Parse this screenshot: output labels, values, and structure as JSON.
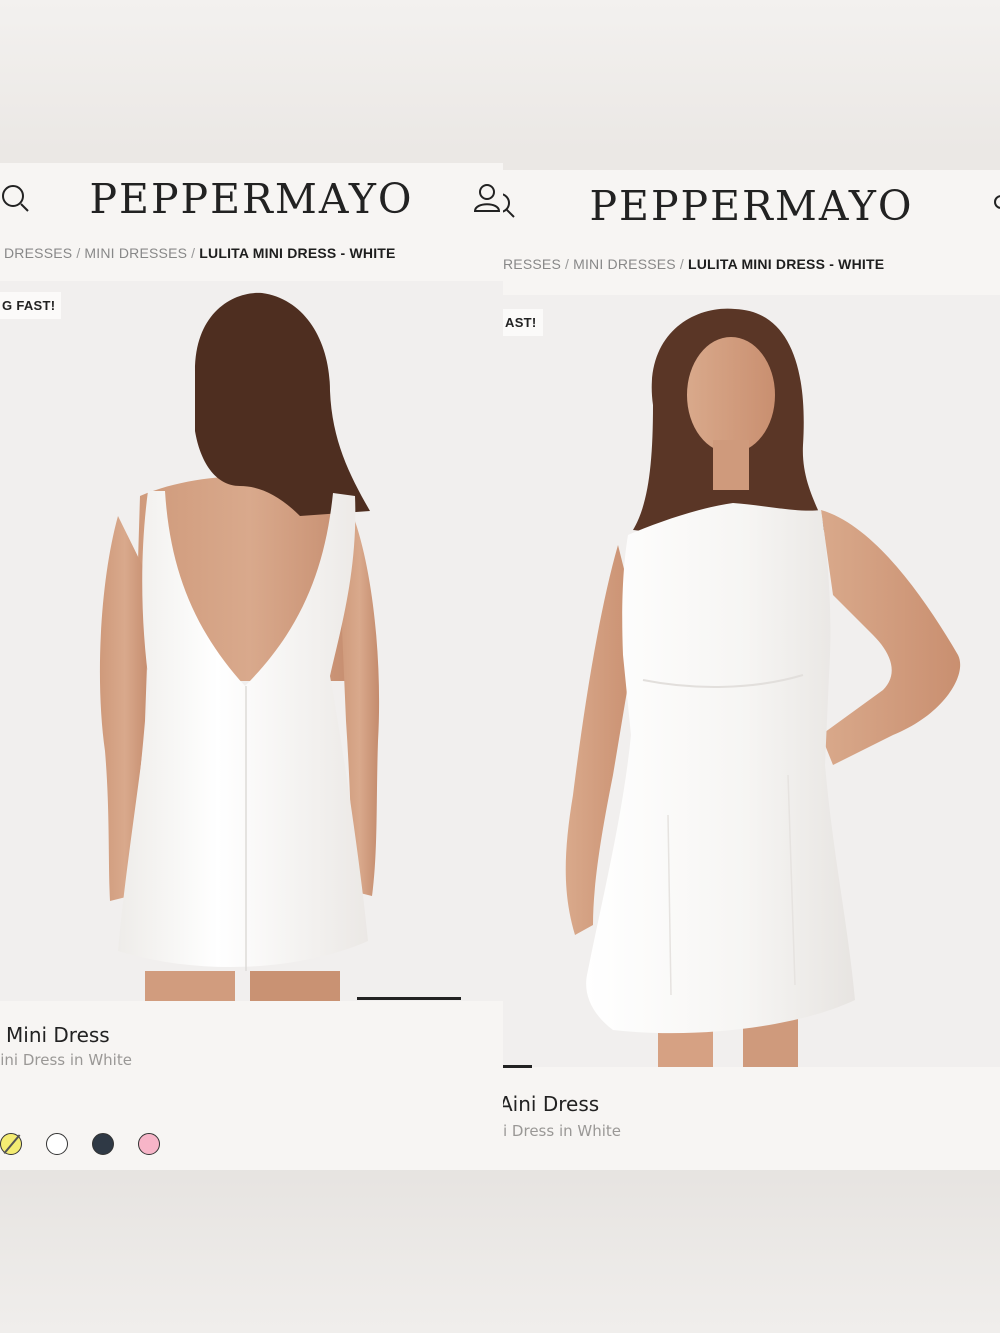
{
  "brand": "PEPPERMAYO",
  "breadcrumb": {
    "left": [
      "DRESSES",
      "MINI DRESSES"
    ],
    "right": [
      "RESSES",
      "MINI DRESSES"
    ],
    "current": "LULITA MINI DRESS - WHITE"
  },
  "badge": {
    "left": "G FAST!",
    "right": "AST!"
  },
  "product": {
    "left_title": "Mini Dress",
    "left_subtitle": "Aini Dress in White",
    "right_title": "Aini Dress",
    "right_subtitle": "i Dress in White"
  },
  "swatches": [
    {
      "name": "yellow",
      "color": "#f4ec73",
      "selected": true
    },
    {
      "name": "white",
      "color": "#ffffff",
      "selected": false
    },
    {
      "name": "navy",
      "color": "#2f3945",
      "selected": false
    },
    {
      "name": "pink",
      "color": "#f7b5c8",
      "selected": false
    }
  ],
  "gallery_progress": {
    "left": 0.25,
    "right": 0.06
  },
  "colors": {
    "accent": "#222222",
    "background": "#f7f5f3",
    "photo_bg": "#f1efee"
  },
  "icons": [
    "search-icon",
    "account-icon"
  ]
}
